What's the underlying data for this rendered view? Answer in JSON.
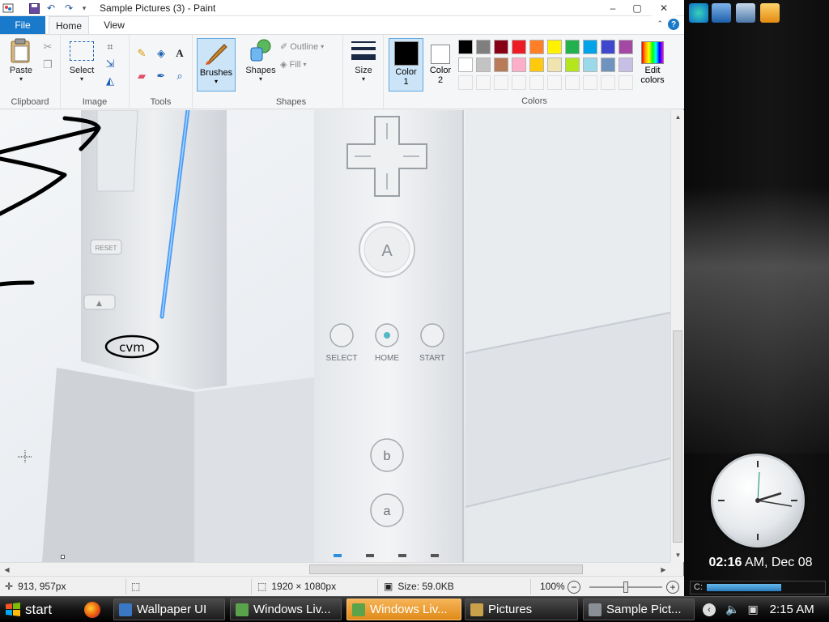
{
  "window": {
    "title": "Sample Pictures (3) - Paint",
    "minimize": "–",
    "maximize": "▢",
    "close": "✕"
  },
  "tabs": {
    "file": "File",
    "home": "Home",
    "view": "View"
  },
  "ribbon": {
    "clipboard": {
      "paste": "Paste",
      "group": "Clipboard"
    },
    "image": {
      "select": "Select",
      "group": "Image"
    },
    "tools": {
      "group": "Tools"
    },
    "brushes": {
      "label": "Brushes"
    },
    "shapes": {
      "label": "Shapes",
      "outline": "Outline",
      "fill": "Fill",
      "group": "Shapes"
    },
    "size": {
      "label": "Size"
    },
    "colors": {
      "color1": "Color",
      "color1_num": "1",
      "color2": "Color",
      "color2_num": "2",
      "edit": "Edit",
      "edit2": "colors",
      "group": "Colors",
      "color1_value": "#000000",
      "color2_value": "#ffffff",
      "palette_row1": [
        "#000000",
        "#7f7f7f",
        "#880015",
        "#ed1c24",
        "#ff7f27",
        "#fff200",
        "#22b14c",
        "#00a2e8",
        "#3f48cc",
        "#a349a4"
      ],
      "palette_row2": [
        "#ffffff",
        "#c3c3c3",
        "#b97a57",
        "#ffaec9",
        "#ffc90e",
        "#efe4b0",
        "#b5e61d",
        "#99d9ea",
        "#7092be",
        "#c8bfe7"
      ]
    }
  },
  "canvas": {
    "wii_labels": {
      "reset": "RESET",
      "select": "SELECT",
      "home": "HOME",
      "start": "START",
      "a": "A",
      "b": "b",
      "small_a": "a"
    },
    "scribble_text": "cvm"
  },
  "status": {
    "cursor": "913, 957px",
    "dimensions": "1920 × 1080px",
    "size": "Size: 59.0KB",
    "zoom": "100%",
    "zoom_fraction": 0.5
  },
  "gadgets": {
    "time": "02:16",
    "date_suffix": "AM, Dec 08",
    "drive": "C:",
    "disk_usage_fraction": 0.64
  },
  "taskbar": {
    "start": "start",
    "items": [
      {
        "label": "Wallpaper UI",
        "active": false
      },
      {
        "label": "Windows Liv...",
        "active": false
      },
      {
        "label": "Windows Liv...",
        "active": true
      },
      {
        "label": "Pictures",
        "active": false
      },
      {
        "label": "Sample Pict...",
        "active": false
      }
    ],
    "clock": "2:15 AM"
  }
}
